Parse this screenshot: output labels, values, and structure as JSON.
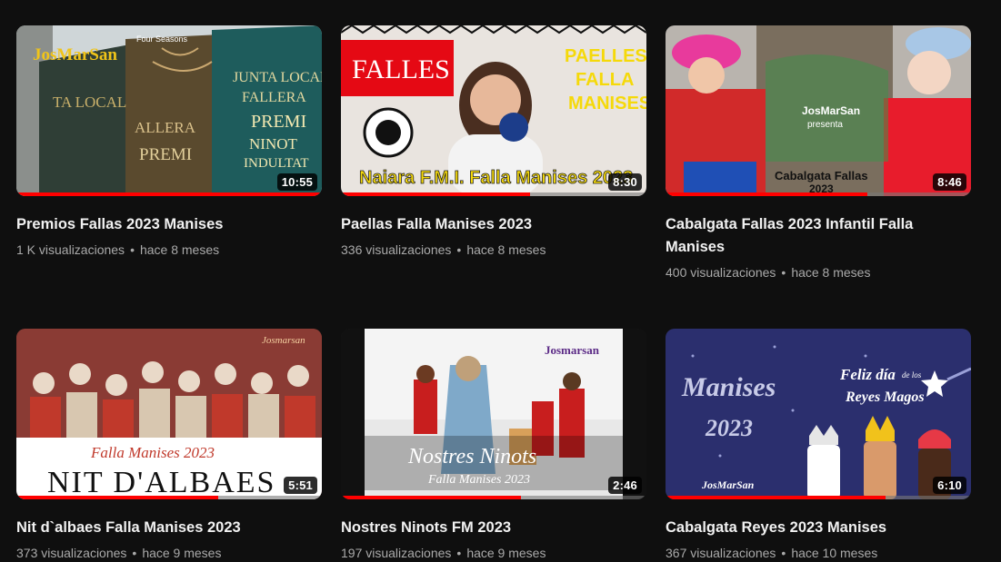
{
  "colors": {
    "background": "#0f0f0f",
    "accent": "#ff0000",
    "meta_text": "#aaaaaa"
  },
  "videos": [
    {
      "title": "Premios Fallas 2023 Manises",
      "views": "1 K visualizaciones",
      "age": "hace 8 meses",
      "duration": "10:55",
      "watched_fraction": 1.0,
      "thumb": {
        "t1": "JosMarSan",
        "t2": "Four Seasons",
        "t3": "TA LOCAL",
        "t4": "ALLERA",
        "t5": "PREMI",
        "t6": "JUNTA LOCAL",
        "t7": "FALLERA",
        "t8": "PREMI",
        "t9": "NINOT",
        "t10": "INDULTAT"
      }
    },
    {
      "title": "Paellas Falla Manises 2023",
      "views": "336 visualizaciones",
      "age": "hace 8 meses",
      "duration": "8:30",
      "watched_fraction": 0.62,
      "thumb": {
        "t1": "FALLES",
        "t2": "PAELLES",
        "t3": "FALLA",
        "t4": "MANISES",
        "t5": "Naiara   F.M.I. Falla Manises 2023"
      }
    },
    {
      "title": "Cabalgata Fallas 2023 Infantil Falla Manises",
      "views": "400 visualizaciones",
      "age": "hace 8 meses",
      "duration": "8:46",
      "watched_fraction": 0.66,
      "thumb": {
        "t1": "JosMarSan",
        "t2": "presenta",
        "t3": "Cabalgata Fallas",
        "t4": "2023"
      }
    },
    {
      "title": "Nit d`albaes Falla Manises 2023",
      "views": "373 visualizaciones",
      "age": "hace 9 meses",
      "duration": "5:51",
      "watched_fraction": 0.66,
      "thumb": {
        "t1": "Josmarsan",
        "t2": "Falla Manises 2023",
        "t3": "NIT D'ALBAES"
      }
    },
    {
      "title": "Nostres Ninots FM 2023",
      "views": "197 visualizaciones",
      "age": "hace 9 meses",
      "duration": "2:46",
      "watched_fraction": 0.59,
      "thumb": {
        "t1": "Josmarsan",
        "t2": "Nostres Ninots",
        "t3": "Falla Manises 2023"
      }
    },
    {
      "title": "Cabalgata Reyes 2023 Manises",
      "views": "367 visualizaciones",
      "age": "hace 10 meses",
      "duration": "6:10",
      "watched_fraction": 0.72,
      "thumb": {
        "t1": "Manises",
        "t2": "2023",
        "t3": "Feliz día",
        "t4": "de los",
        "t5": "Reyes Magos",
        "t6": "JosMarSan"
      }
    }
  ]
}
